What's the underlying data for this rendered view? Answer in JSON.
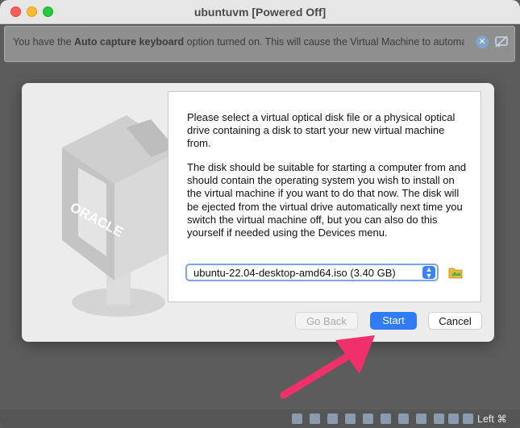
{
  "window": {
    "title": "ubuntuvm [Powered Off]"
  },
  "notification": {
    "text_prefix": "You have the ",
    "text_bold": "Auto capture keyboard",
    "text_suffix": " option turned on. This will cause the Virtual Machine to automatically",
    "close_icon": "close-circle-icon",
    "mute_icon": "mute-notification-icon"
  },
  "dialog": {
    "logo_text": "ORACLE",
    "paragraph1": "Please select a virtual optical disk file or a physical optical drive containing a disk to start your new virtual machine from.",
    "paragraph2": "The disk should be suitable for starting a computer from and should contain the operating system you wish to install on the virtual machine if you want to do that now. The disk will be ejected from the virtual drive automatically next time you switch the virtual machine off, but you can also do this yourself if needed using the Devices menu.",
    "selected_disk": "ubuntu-22.04-desktop-amd64.iso (3.40 GB)",
    "folder_icon": "folder-icon",
    "buttons": {
      "back": "Go Back",
      "start": "Start",
      "cancel": "Cancel"
    }
  },
  "statusbar": {
    "host_key": "Left ⌘"
  },
  "colors": {
    "accent": "#2f7cf6",
    "annotation_arrow": "#f0306a"
  }
}
